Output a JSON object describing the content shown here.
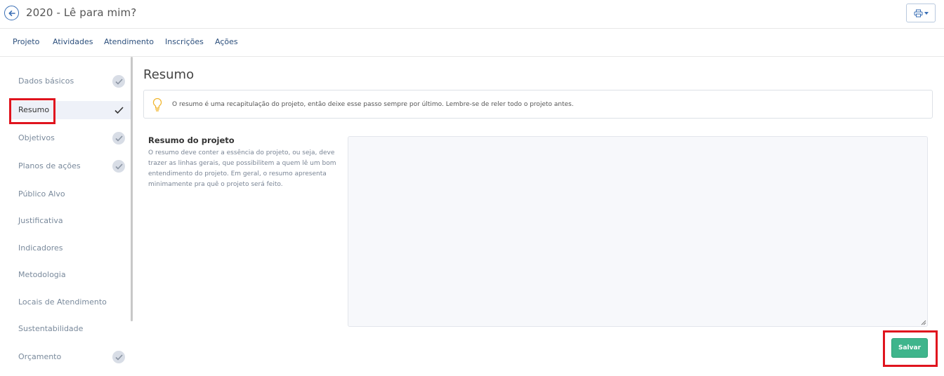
{
  "header": {
    "title": "2020 - Lê para mim?",
    "back_icon": "arrow-left-icon",
    "print_icon": "printer-icon"
  },
  "nav": {
    "tabs": [
      {
        "label": "Projeto"
      },
      {
        "label": "Atividades"
      },
      {
        "label": "Atendimento"
      },
      {
        "label": "Inscrições"
      },
      {
        "label": "Ações"
      }
    ]
  },
  "sidebar": {
    "items": [
      {
        "label": "Dados básicos",
        "done": true
      },
      {
        "label": "Resumo",
        "done": true,
        "active": true
      },
      {
        "label": "Objetivos",
        "done": true
      },
      {
        "label": "Planos de ações",
        "done": true
      },
      {
        "label": "Público Alvo",
        "done": false
      },
      {
        "label": "Justificativa",
        "done": false
      },
      {
        "label": "Indicadores",
        "done": false
      },
      {
        "label": "Metodologia",
        "done": false
      },
      {
        "label": "Locais de Atendimento",
        "done": false
      },
      {
        "label": "Sustentabilidade",
        "done": false
      },
      {
        "label": "Orçamento",
        "done": true
      }
    ]
  },
  "main": {
    "title": "Resumo",
    "info": "O resumo é uma recapitulação do projeto, então deixe esse passo sempre por último. Lembre-se de reler todo o projeto antes.",
    "field_label": "Resumo do projeto",
    "field_help": "O resumo deve conter a essência do projeto, ou seja, deve trazer as linhas gerais, que possibilitem a quem lê um bom entendimento do projeto. Em geral, o resumo apresenta minimamente pra quê o projeto será feito.",
    "field_value": "",
    "save_label": "Salvar"
  },
  "colors": {
    "accent": "#2c4f7c",
    "save": "#3fb58c",
    "highlight": "#e0141e",
    "bulb": "#f0b429"
  }
}
